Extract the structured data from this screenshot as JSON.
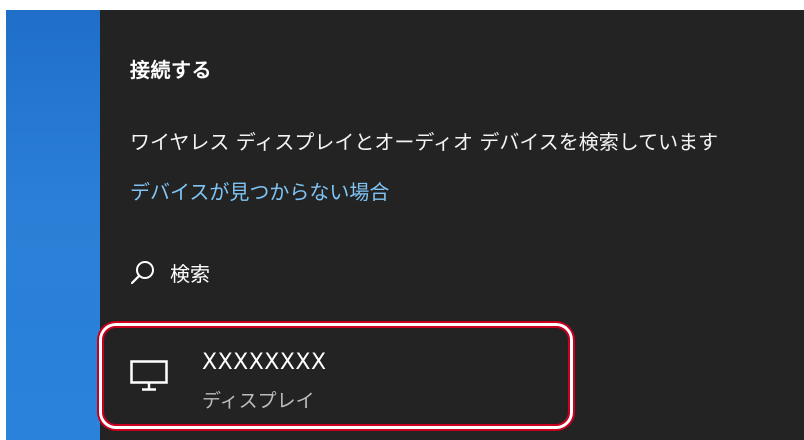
{
  "panel": {
    "title": "接続する",
    "searching_text": "ワイヤレス ディスプレイとオーディオ デバイスを検索しています",
    "help_link": "デバイスが見つからない場合"
  },
  "search": {
    "label": "検索",
    "icon": "search-icon"
  },
  "devices": [
    {
      "name": "XXXXXXXX",
      "type": "ディスプレイ",
      "icon": "monitor-icon"
    }
  ],
  "colors": {
    "panel_background": "#232323",
    "accent_strip": "#2a82da",
    "link": "#7fc4f4",
    "highlight_border": "#c8001e"
  }
}
